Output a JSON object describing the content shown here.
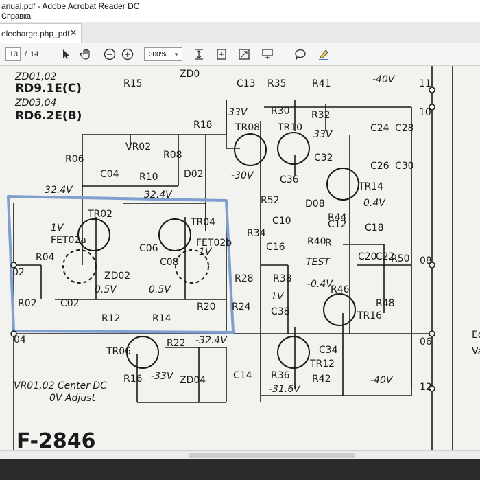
{
  "window": {
    "title": "anual.pdf - Adobe Acrobat Reader DC"
  },
  "menu": {
    "help": "Справка"
  },
  "tab": {
    "label": "elecharge.php_pdf...",
    "close": "✕"
  },
  "toolbar": {
    "page_current": "13",
    "page_sep": "/",
    "page_total": "14",
    "zoom": "300%"
  },
  "schematic": {
    "zd01_02": "ZD01,02",
    "rd91e": "RD9.1E(C)",
    "zd03_04": "ZD03,04",
    "rd62e": "RD6.2E(B)",
    "v40_top": "-40V",
    "n11": "11",
    "n10": "10",
    "v33_a": "33V",
    "v33_b": "33V",
    "tr08": "TR08",
    "tr10": "TR10",
    "tr14": "TR14",
    "tr02": "TR02",
    "tr04": "TR04",
    "tr06": "TR06",
    "tr12": "TR12",
    "tr16": "TR16",
    "r30": "R30",
    "r32": "R32",
    "r18": "R18",
    "r06": "R06",
    "r08": "R08",
    "r10": "R10",
    "r04": "R04",
    "r02": "R02",
    "r12": "R12",
    "r14": "R14",
    "r16": "R16",
    "r20": "R20",
    "r22": "R22",
    "r24": "R24",
    "r28": "R28",
    "r34": "R34",
    "r36": "R36",
    "r38": "R38",
    "r40": "R40",
    "r42": "R42",
    "r44": "R44",
    "r46": "R46",
    "r48": "R48",
    "r50": "R50",
    "r52": "R52",
    "vr02": "VR02",
    "d02": "D02",
    "d08": "D08",
    "c04": "C04",
    "c02": "C02",
    "c06": "C06",
    "c08": "C08",
    "c10": "C10",
    "c12": "C12",
    "c14": "C14",
    "c16": "C16",
    "c18": "C18",
    "c20": "C20",
    "c22": "C22",
    "c24": "C24",
    "c26": "C26",
    "c28": "C28",
    "c30": "C30",
    "c32": "C32",
    "c34": "C34",
    "c36": "C36",
    "c38": "C38",
    "zd02": "ZD02",
    "zd04": "ZD04",
    "v30": "-30V",
    "v324_a": "32.4V",
    "v324_b": "32.4V",
    "v324_c": "-32.4V",
    "v1_a": "1V",
    "v1_b": "1V",
    "v1_c": "1V",
    "fet02a": "FET02a",
    "fet02b": "FET02b",
    "v05_a": "0.5V",
    "v05_b": "0.5V",
    "v04": "0.4V",
    "vm04": "-0.4V",
    "vm33": "-33V",
    "vm316": "-31.6V",
    "vm40": "-40V",
    "test": "TEST",
    "n02": "02",
    "n04": "04",
    "n06": "06",
    "n08": "08",
    "n12": "12",
    "vr_note1": "VR01,02 Center DC",
    "vr_note2": "0V Adjust",
    "fig": "F-2846",
    "r15": "R15",
    "r35": "R35",
    "r41": "R41",
    "c13": "C13",
    "zd0x": "ZD0",
    "r_mark": "R",
    "ed": "Ed",
    "va": "Va"
  },
  "colors": {
    "highlight": "#7f9fd0",
    "ink": "#1a1a1a",
    "paper": "#f2f2ee"
  }
}
